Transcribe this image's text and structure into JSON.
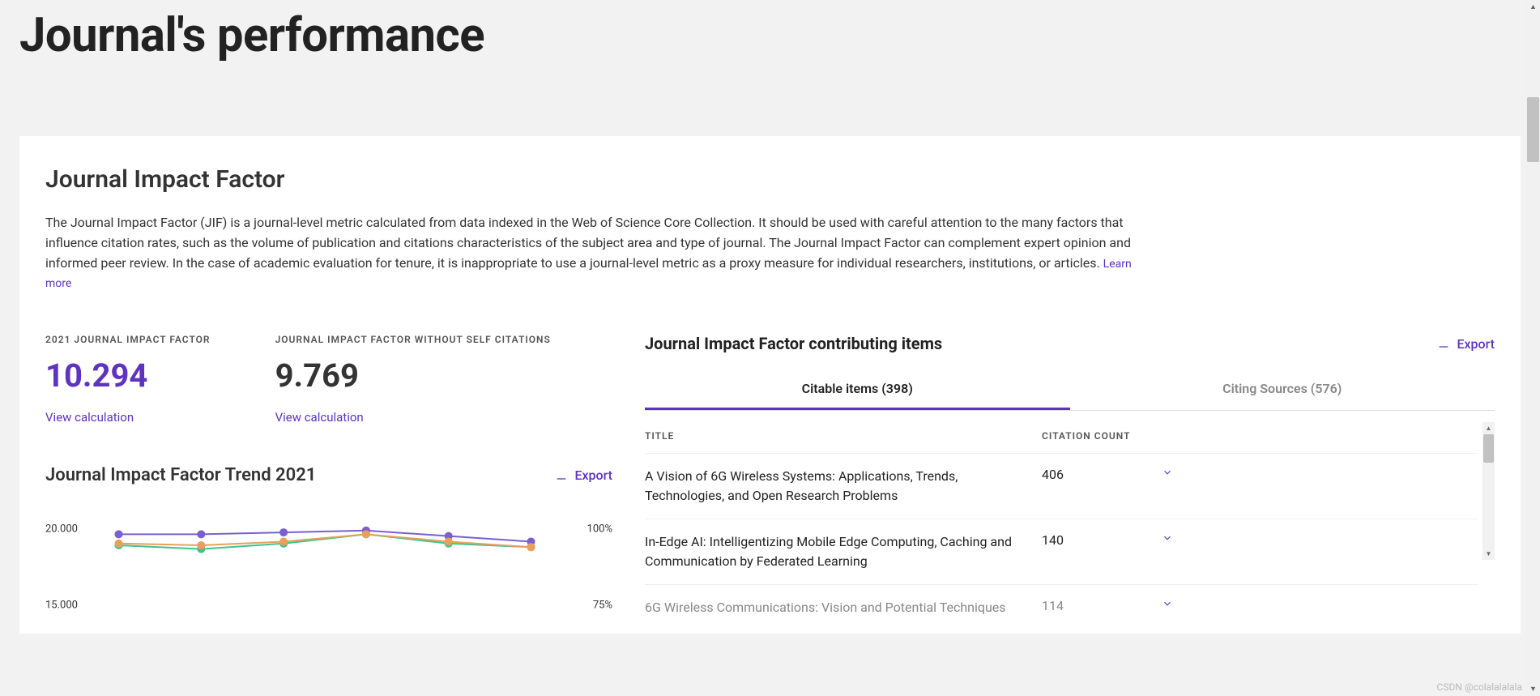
{
  "page": {
    "title": "Journal's performance"
  },
  "section": {
    "title": "Journal Impact Factor",
    "description": "The Journal Impact Factor (JIF) is a journal-level metric calculated from data indexed in the Web of Science Core Collection. It should be used with careful attention to the many factors that influence citation rates, such as the volume of publication and citations characteristics of the subject area and type of journal. The Journal Impact Factor can complement expert opinion and informed peer review. In the case of academic evaluation for tenure, it is inappropriate to use a journal-level metric as a proxy measure for individual researchers, institutions, or articles.",
    "learn_more": "Learn more"
  },
  "metrics": {
    "jif": {
      "label": "2021 JOURNAL IMPACT FACTOR",
      "value": "10.294",
      "link": "View calculation"
    },
    "jif_noself": {
      "label": "JOURNAL IMPACT FACTOR WITHOUT SELF CITATIONS",
      "value": "9.769",
      "link": "View calculation"
    }
  },
  "trend": {
    "title": "Journal Impact Factor Trend 2021",
    "export": "Export",
    "left_ticks": [
      "20.000",
      "15.000"
    ],
    "right_ticks": [
      "100%",
      "75%"
    ]
  },
  "contrib": {
    "title": "Journal Impact Factor contributing items",
    "export": "Export",
    "tab_active": "Citable items (398)",
    "tab_inactive": "Citing Sources (576)",
    "col_title": "TITLE",
    "col_count": "CITATION COUNT",
    "rows": [
      {
        "title": "A Vision of 6G Wireless Systems: Applications, Trends, Technologies, and Open Research Problems",
        "count": "406"
      },
      {
        "title": "In-Edge AI: Intelligentizing Mobile Edge Computing, Caching and Communication by Federated Learning",
        "count": "140"
      },
      {
        "title": "6G Wireless Communications: Vision and Potential Techniques",
        "count": "114"
      }
    ]
  },
  "chart_data": {
    "type": "line",
    "title": "Journal Impact Factor Trend 2021",
    "y_left": {
      "label": "",
      "range": [
        0,
        20
      ],
      "ticks": [
        20,
        15
      ]
    },
    "y_right": {
      "label": "",
      "range": [
        0,
        100
      ],
      "ticks": [
        100,
        75
      ],
      "unit": "%"
    },
    "x_points": [
      1,
      2,
      3,
      4,
      5,
      6
    ],
    "series": [
      {
        "name": "series-purple",
        "color": "#7a5fd0",
        "values": [
          18.8,
          18.8,
          18.9,
          19.0,
          18.7,
          18.4
        ]
      },
      {
        "name": "series-green",
        "color": "#41c28f",
        "values": [
          18.2,
          18.0,
          18.3,
          18.8,
          18.3,
          18.1
        ]
      },
      {
        "name": "series-orange",
        "color": "#e8a05a",
        "values": [
          18.3,
          18.2,
          18.4,
          18.8,
          18.4,
          18.1
        ]
      }
    ]
  },
  "watermark": "CSDN @colalalalala"
}
